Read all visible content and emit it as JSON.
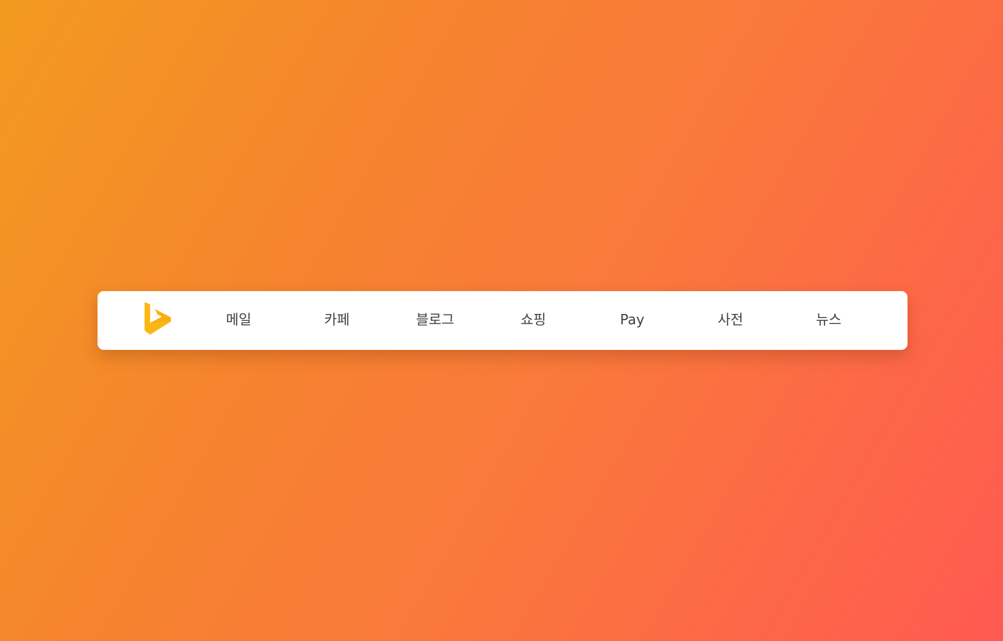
{
  "background": {
    "gradient_colors": [
      "#f29a1f",
      "#f6822f",
      "#f97a3a",
      "#ff5a51"
    ]
  },
  "navbar": {
    "logo": {
      "icon": "bing-logo-icon",
      "color": "#fbb812"
    },
    "items": [
      {
        "label": "메일"
      },
      {
        "label": "카페"
      },
      {
        "label": "블로그"
      },
      {
        "label": "쇼핑"
      },
      {
        "label": "Pay"
      },
      {
        "label": "사전"
      },
      {
        "label": "뉴스"
      }
    ]
  }
}
